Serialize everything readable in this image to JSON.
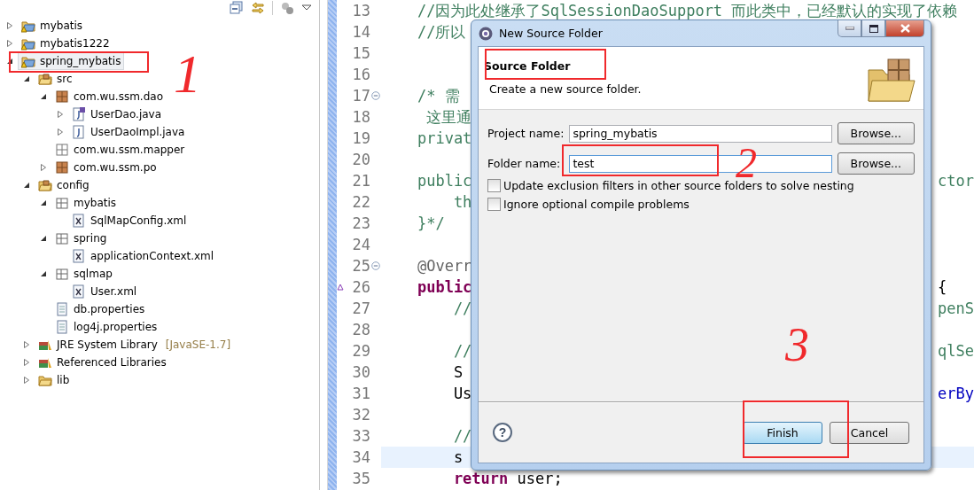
{
  "explorer": {
    "tree": [
      {
        "label": "mybatis",
        "kind": "project",
        "expanded": false,
        "selected": false
      },
      {
        "label": "mybatis1222",
        "kind": "project",
        "expanded": false,
        "selected": false
      },
      {
        "label": "spring_mybatis",
        "kind": "project",
        "expanded": true,
        "selected": true,
        "children": [
          {
            "label": "src",
            "kind": "srcfolder",
            "expanded": true,
            "selected": false,
            "children": [
              {
                "label": "com.wu.ssm.dao",
                "kind": "package",
                "expanded": true,
                "selected": false,
                "children": [
                  {
                    "label": "UserDao.java",
                    "kind": "interface",
                    "expanded": false,
                    "selected": false
                  },
                  {
                    "label": "UserDaoImpl.java",
                    "kind": "java",
                    "expanded": false,
                    "selected": false
                  }
                ]
              },
              {
                "label": "com.wu.ssm.mapper",
                "kind": "emptypackage",
                "selected": false
              },
              {
                "label": "com.wu.ssm.po",
                "kind": "package",
                "expanded": false,
                "selected": false
              }
            ]
          },
          {
            "label": "config",
            "kind": "srcfolder",
            "expanded": true,
            "selected": false,
            "children": [
              {
                "label": "mybatis",
                "kind": "resfolder",
                "expanded": true,
                "selected": false,
                "children": [
                  {
                    "label": "SqlMapConfig.xml",
                    "kind": "xml",
                    "selected": false
                  }
                ]
              },
              {
                "label": "spring",
                "kind": "resfolder",
                "expanded": true,
                "selected": false,
                "children": [
                  {
                    "label": "applicationContext.xml",
                    "kind": "xml",
                    "selected": false
                  }
                ]
              },
              {
                "label": "sqlmap",
                "kind": "resfolder",
                "expanded": true,
                "selected": false,
                "children": [
                  {
                    "label": "User.xml",
                    "kind": "xml",
                    "selected": false
                  }
                ]
              },
              {
                "label": "db.properties",
                "kind": "file",
                "selected": false
              },
              {
                "label": "log4j.properties",
                "kind": "file",
                "selected": false
              }
            ]
          },
          {
            "label": "JRE System Library",
            "suffix": "[JavaSE-1.7]",
            "kind": "library",
            "expanded": false,
            "selected": false
          },
          {
            "label": "Referenced Libraries",
            "kind": "library",
            "expanded": false,
            "selected": false
          },
          {
            "label": "lib",
            "kind": "folder",
            "expanded": false,
            "selected": false
          }
        ]
      }
    ]
  },
  "editor": {
    "lines": [
      {
        "number": "13",
        "fold": false,
        "override": false,
        "current": false,
        "segments": [
          {
            "text": "    //因为此处继承了SqlSessionDaoSupport 而此类中，已经默认的实现了依赖",
            "kind": "comment"
          }
        ]
      },
      {
        "number": "14",
        "fold": false,
        "override": false,
        "current": false,
        "segments": [
          {
            "text": "    //所以",
            "kind": "comment"
          }
        ]
      },
      {
        "number": "15",
        "fold": false,
        "override": false,
        "current": false
      },
      {
        "number": "16",
        "fold": false,
        "override": false,
        "current": false
      },
      {
        "number": "17",
        "fold": true,
        "override": false,
        "current": false,
        "segments": [
          {
            "text": "    /* 需",
            "kind": "comment"
          }
        ]
      },
      {
        "number": "18",
        "fold": false,
        "override": false,
        "current": false,
        "segments": [
          {
            "text": "     这里通",
            "kind": "comment"
          }
        ]
      },
      {
        "number": "19",
        "fold": false,
        "override": false,
        "current": false,
        "segments": [
          {
            "text": "    privat",
            "kind": "comment"
          }
        ]
      },
      {
        "number": "20",
        "fold": false,
        "override": false,
        "current": false
      },
      {
        "number": "21",
        "fold": false,
        "override": false,
        "current": false,
        "segments": [
          {
            "text": "    public",
            "kind": "comment"
          }
        ],
        "right": {
          "text": "ctor",
          "kind": "comment"
        }
      },
      {
        "number": "22",
        "fold": false,
        "override": false,
        "current": false,
        "segments": [
          {
            "text": "        th",
            "kind": "comment"
          }
        ]
      },
      {
        "number": "23",
        "fold": false,
        "override": false,
        "current": false,
        "segments": [
          {
            "text": "    }*/",
            "kind": "comment"
          }
        ]
      },
      {
        "number": "24",
        "fold": false,
        "override": false,
        "current": false
      },
      {
        "number": "25",
        "fold": true,
        "override": false,
        "current": false,
        "segments": [
          {
            "text": "    @Overr",
            "kind": "annotation"
          }
        ]
      },
      {
        "number": "26",
        "fold": false,
        "override": true,
        "current": false,
        "segments": [
          {
            "text": "    public",
            "kind": "keyword"
          }
        ],
        "right": {
          "text": "{",
          "kind": "plain"
        }
      },
      {
        "number": "27",
        "fold": false,
        "override": false,
        "current": false,
        "segments": [
          {
            "text": "        //",
            "kind": "comment"
          }
        ],
        "right": {
          "text": "penS",
          "kind": "comment"
        }
      },
      {
        "number": "28",
        "fold": false,
        "override": false,
        "current": false
      },
      {
        "number": "29",
        "fold": false,
        "override": false,
        "current": false,
        "segments": [
          {
            "text": "        //",
            "kind": "comment"
          }
        ],
        "right": {
          "text": "qlSe",
          "kind": "comment"
        }
      },
      {
        "number": "30",
        "fold": false,
        "override": false,
        "current": false,
        "segments": [
          {
            "text": "        S",
            "kind": "plain"
          }
        ]
      },
      {
        "number": "31",
        "fold": false,
        "override": false,
        "current": false,
        "segments": [
          {
            "text": "        Us",
            "kind": "plain"
          }
        ],
        "right": {
          "text": "erBy",
          "kind": "method"
        }
      },
      {
        "number": "32",
        "fold": false,
        "override": false,
        "current": false
      },
      {
        "number": "33",
        "fold": false,
        "override": false,
        "current": false,
        "segments": [
          {
            "text": "        //",
            "kind": "comment"
          }
        ]
      },
      {
        "number": "34",
        "fold": false,
        "override": false,
        "current": true,
        "segments": [
          {
            "text": "        s",
            "kind": "plain"
          }
        ]
      },
      {
        "number": "35",
        "fold": false,
        "override": false,
        "current": false,
        "segments": [
          {
            "text": "        return",
            "kind": "keyword"
          },
          {
            "text": " user;",
            "kind": "plain"
          }
        ]
      }
    ]
  },
  "dialog": {
    "title": "New Source Folder",
    "heading": "Source Folder",
    "description": "Create a new source folder.",
    "fields": [
      {
        "label": "Project name:",
        "value": "spring_mybatis",
        "focused": false,
        "button": "Browse..."
      },
      {
        "label": "Folder name:",
        "value": "test",
        "focused": true,
        "button": "Browse..."
      }
    ],
    "checkboxes": [
      {
        "label": "Update exclusion filters in other source folders to solve nesting",
        "checked": false
      },
      {
        "label": "Ignore optional compile problems",
        "checked": false
      }
    ],
    "help": "?",
    "buttons": [
      {
        "label": "Finish",
        "default": true
      },
      {
        "label": "Cancel",
        "default": false
      }
    ]
  },
  "annotations": [
    {
      "label": "1"
    },
    {
      "label": "2"
    },
    {
      "label": "3"
    }
  ]
}
